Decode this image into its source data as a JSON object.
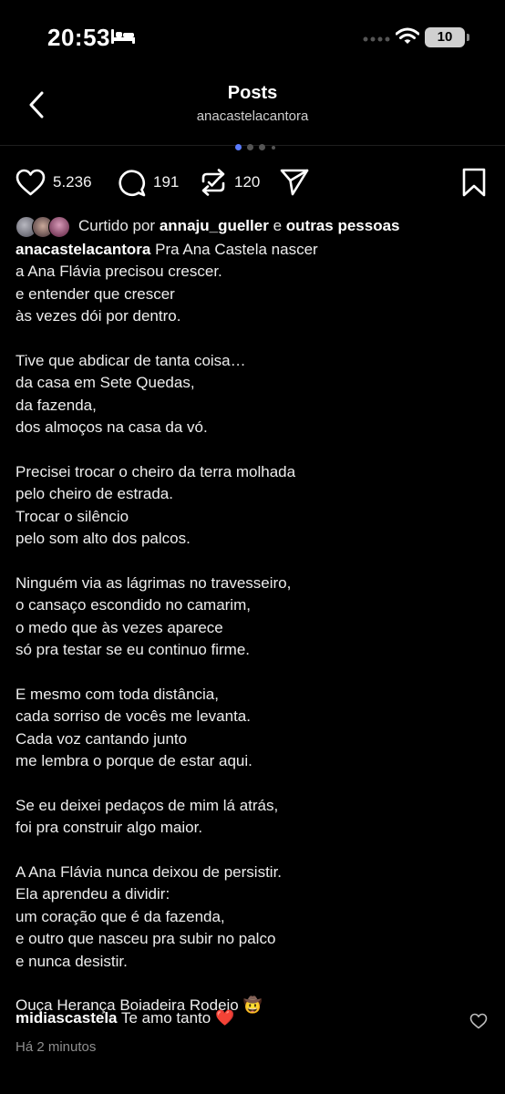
{
  "status_bar": {
    "time": "20:53",
    "battery": "10"
  },
  "header": {
    "title": "Posts",
    "subtitle": "anacastelacantora"
  },
  "actions": {
    "likes": "5.236",
    "comments": "191",
    "reposts": "120"
  },
  "liked_by": {
    "prefix": "Curtido por",
    "user": "annaju_gueller",
    "conj": "e",
    "others": "outras pessoas"
  },
  "caption": {
    "username": "anacastelacantora",
    "lines": [
      "Pra Ana Castela nascer",
      "a Ana Flávia precisou crescer.",
      "e entender que crescer",
      "às vezes dói por dentro.",
      "",
      "Tive que abdicar de tanta coisa…",
      "da casa em Sete Quedas,",
      "da fazenda,",
      "dos almoços na casa da vó.",
      "",
      "Precisei trocar o cheiro da terra molhada",
      "pelo cheiro de estrada.",
      "Trocar o silêncio",
      "pelo som alto dos palcos.",
      "",
      "Ninguém via as lágrimas no travesseiro,",
      "o cansaço escondido no camarim,",
      "o medo que às vezes aparece",
      "só pra testar se eu continuo firme.",
      "",
      "E mesmo com toda distância,",
      "cada sorriso de vocês me levanta.",
      "Cada voz cantando junto",
      "me lembra o porque de estar aqui.",
      "",
      "Se eu deixei pedaços de mim lá atrás,",
      "foi pra construir algo maior.",
      "",
      "A Ana Flávia nunca deixou de persistir.",
      "Ela aprendeu a dividir:",
      "um coração que é da fazenda,",
      "e outro que nasceu pra subir no palco",
      "e nunca desistir.",
      "",
      "Ouça Herança Boiadeira Rodeio 🤠"
    ]
  },
  "comment": {
    "user": "midiascastela",
    "text": "Te amo tanto ❤️"
  },
  "timestamp": "Há 2 minutos",
  "colors": {
    "background": "#000000",
    "active_dot": "#5b7cff",
    "heart_red": "#e8283b"
  }
}
